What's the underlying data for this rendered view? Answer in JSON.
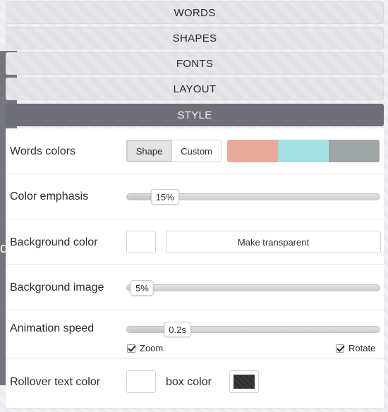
{
  "tabs": [
    {
      "label": "WORDS",
      "active": false
    },
    {
      "label": "SHAPES",
      "active": false
    },
    {
      "label": "FONTS",
      "active": false
    },
    {
      "label": "LAYOUT",
      "active": false
    },
    {
      "label": "STYLE",
      "active": true
    }
  ],
  "left_strip": {
    "letter": "d"
  },
  "style": {
    "words_colors": {
      "label": "Words colors",
      "options": [
        "Shape",
        "Custom"
      ],
      "selected": "Shape",
      "swatches": [
        "#e8aa9a",
        "#a7e0e3",
        "#9fa4a5"
      ]
    },
    "color_emphasis": {
      "label": "Color emphasis",
      "value": "15%",
      "level": 0.15
    },
    "background_color": {
      "label": "Background color",
      "color": "#ffffff",
      "transparent_button": "Make transparent"
    },
    "background_image": {
      "label": "Background image",
      "value": "5%",
      "level": 0.05
    },
    "animation_speed": {
      "label": "Animation speed",
      "value": "0.2s",
      "level": 0.2,
      "zoom": {
        "label": "Zoom",
        "checked": true
      },
      "rotate": {
        "label": "Rotate",
        "checked": true
      }
    },
    "rollover": {
      "label": "Rollover text color",
      "text_color": "#ffffff",
      "box_label": "box color",
      "box_color": "#333333"
    }
  }
}
